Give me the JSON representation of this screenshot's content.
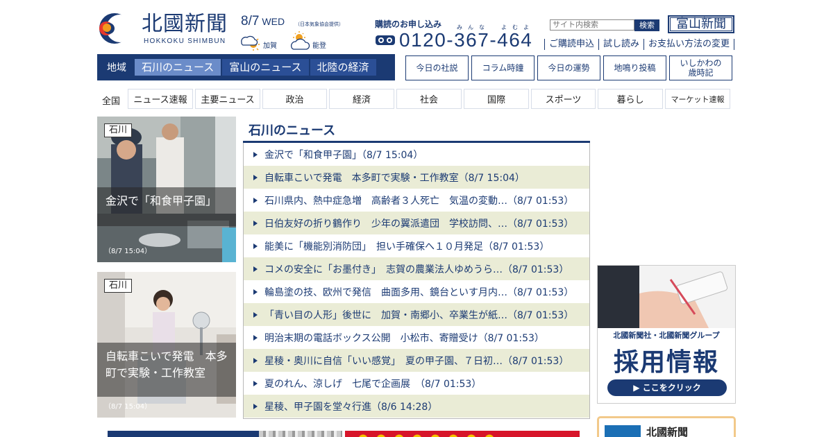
{
  "header": {
    "logo_name": "北國新聞",
    "logo_roman": "HOKKOKU SHIMBUN",
    "date": "8/7",
    "weekday": "WED",
    "weather_source": "（日本気象協会提供）",
    "weather": [
      {
        "area": "加賀",
        "icon": "sun-cloud-icon"
      },
      {
        "area": "能登",
        "icon": "cloud-sun-icon"
      }
    ],
    "subscription_title": "購読のお申し込み",
    "ruby_minna": "みんな",
    "ruby_yoyo": "よむよ",
    "freedial_icon": "freedial-icon",
    "phone": "0120-367-464",
    "search_placeholder": "サイト内検索",
    "search_button": "検索",
    "toyama_banner": "富山新聞",
    "links": [
      "ご購読申込",
      "試し読み",
      "お支払い方法の変更"
    ]
  },
  "region_nav": {
    "label": "地域",
    "tabs": [
      {
        "label": "石川のニュース",
        "active": true
      },
      {
        "label": "富山のニュース",
        "active": false
      },
      {
        "label": "北陸の経済",
        "active": false
      }
    ]
  },
  "feature_buttons": [
    "今日の社説",
    "コラム時鐘",
    "今日の運勢",
    "地鳴り投稿",
    "いしかわの\n歳時記"
  ],
  "category_nav": {
    "label": "全国",
    "items": [
      "ニュース速報",
      "主要ニュース",
      "政治",
      "経済",
      "社会",
      "国際",
      "スポーツ",
      "暮らし",
      "マーケット速報"
    ]
  },
  "photo_cards": [
    {
      "tag": "石川",
      "caption": "金沢で「和食甲子園」",
      "time": "（8/7 15:04）"
    },
    {
      "tag": "石川",
      "caption": "自転車こいで発電　本多町で実験・工作教室",
      "time": "（8/7 15:04）"
    }
  ],
  "news": {
    "heading": "石川のニュース",
    "items": [
      "金沢で「和食甲子園」（8/7 15:04）",
      "自転車こいで発電　本多町で実験・工作教室（8/7 15:04）",
      "石川県内、熱中症急増　高齢者３人死亡　気温の変動…（8/7 01:53）",
      "日伯友好の折り鶴作り　少年の翼派遣団　学校訪問、…（8/7 01:53）",
      "能美に「機能別消防団」　担い手確保へ１０月発足（8/7 01:53）",
      "コメの安全に「お墨付き」　志賀の農業法人ゆめうら…（8/7 01:53）",
      "輪島塗の技、欧州で発信　曲面多用、鏡台といす月内…（8/7 01:53）",
      "「青い目の人形」後世に　加賀・南郷小、卒業生が紙…（8/7 01:53）",
      "明治末期の電話ボックス公開　小松市、寄贈受け（8/7 01:53）",
      "星稜・奥川に自信「いい感覚」　夏の甲子園、７日初…（8/7 01:53）",
      "夏のれん、涼しげ　七尾で企画展　（8/7 01:53）",
      "星稜、甲子園を堂々行進（8/6 14:28）"
    ]
  },
  "recruit_ad": {
    "subtitle": "北國新聞社・北國新聞グループ",
    "title": "採用情報",
    "button": "▶ ここをクリック"
  },
  "paper_box": {
    "title": "北國新聞"
  },
  "colors": {
    "brand_navy": "#1b3a73",
    "active_tab": "#6b8cc9",
    "row_shade": "#eaecd6"
  }
}
